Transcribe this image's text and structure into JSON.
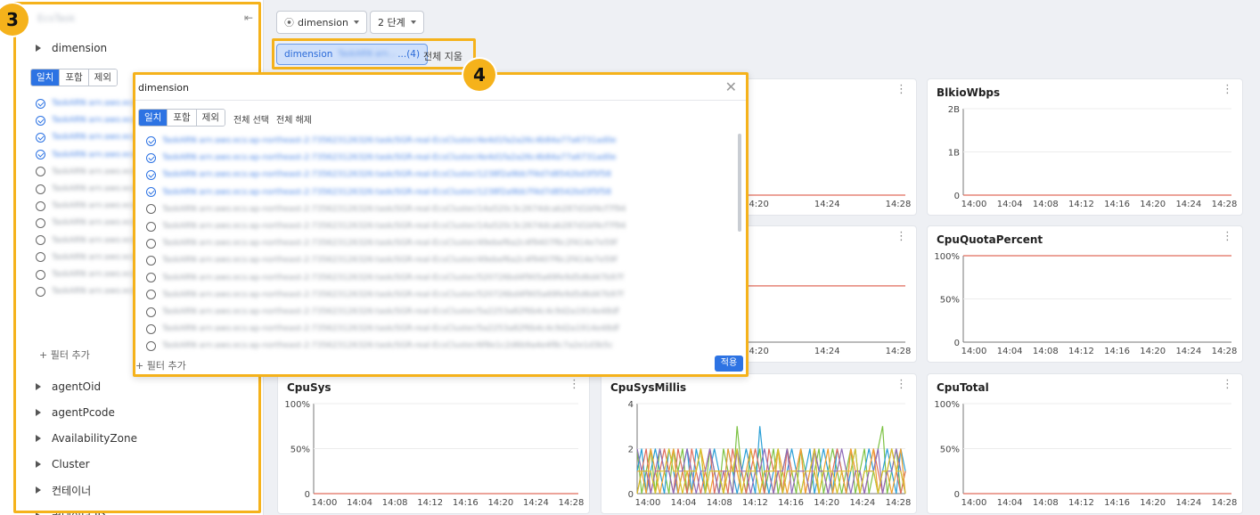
{
  "sidebar": {
    "back_icon": "chevron-left-icon",
    "title": "EcsTask",
    "collapse_icon": "collapse-sidebar-icon",
    "dimension_label": "dimension",
    "match_modes": [
      "일치",
      "포함",
      "제외"
    ],
    "options": [
      {
        "text": "TaskARN arn:aws:ecs",
        "selected": true
      },
      {
        "text": "TaskARN arn:aws:ecs",
        "selected": true
      },
      {
        "text": "TaskARN arn:aws:ecs",
        "selected": true
      },
      {
        "text": "TaskARN arn:aws:ecs",
        "selected": true
      },
      {
        "text": "TaskARN arn:aws:ecs",
        "selected": false
      },
      {
        "text": "TaskARN arn:aws:ecs",
        "selected": false
      },
      {
        "text": "TaskARN arn:aws:ecs",
        "selected": false
      },
      {
        "text": "TaskARN arn:aws:ecs",
        "selected": false
      },
      {
        "text": "TaskARN arn:aws:ecs",
        "selected": false
      },
      {
        "text": "TaskARN arn:aws:ecs",
        "selected": false
      },
      {
        "text": "TaskARN arn:aws:ecs",
        "selected": false
      },
      {
        "text": "TaskARN arn:aws:ecs",
        "selected": false
      }
    ],
    "add_filter": "+ 필터 추가",
    "tree": [
      "agentOid",
      "agentPcode",
      "AvailabilityZone",
      "Cluster",
      "컨테이너",
      "컨테이너 ID"
    ]
  },
  "annotations": {
    "sidebar_badge": "3",
    "filter_badge": "4"
  },
  "toolbar": {
    "group_icon": "group-by-icon",
    "dimension_button": "dimension",
    "level_button": "2 단계",
    "chip_key": "dimension",
    "chip_value": "TaskARN arn...",
    "chip_count": "...(4)",
    "clear_all": "전체 지움"
  },
  "modal": {
    "title": "dimension",
    "close_icon": "close-icon",
    "match_modes": [
      "일치",
      "포함",
      "제외"
    ],
    "select_all": "전체 선택",
    "deselect_all": "전체 해제",
    "options": [
      {
        "text": "TaskARN arn:aws:ecs:ap-northeast-2:735623126326:task/SGR-real-EcsCluster/4e4d1fa2a26c4b84a77a6731ad0e",
        "selected": true
      },
      {
        "text": "TaskARN arn:aws:ecs:ap-northeast-2:735623126326:task/SGR-real-EcsCluster/4e4d1fa2a26c4b84a77a6731ad0e",
        "selected": true
      },
      {
        "text": "TaskARN arn:aws:ecs:ap-northeast-2:735623126326:task/SGR-real-EcsCluster/1238f2a9bb7f4d7d8542bd3f5f58",
        "selected": true
      },
      {
        "text": "TaskARN arn:aws:ecs:ap-northeast-2:735623126326:task/SGR-real-EcsCluster/1238f2a9bb7f4d7d8542bd3f5f58",
        "selected": true
      },
      {
        "text": "TaskARN arn:aws:ecs:ap-northeast-2:735623126326:task/SGR-real-EcsCluster/14a520c3c2674dcab287d1bf4cf7f94",
        "selected": false
      },
      {
        "text": "TaskARN arn:aws:ecs:ap-northeast-2:735623126326:task/SGR-real-EcsCluster/14a520c3c2674dcab287d1bf4cf7f94",
        "selected": false
      },
      {
        "text": "TaskARN arn:aws:ecs:ap-northeast-2:735623126326:task/SGR-real-EcsCluster/49ebef6a2c4f9407f6c2f414e7e59f",
        "selected": false
      },
      {
        "text": "TaskARN arn:aws:ecs:ap-northeast-2:735623126326:task/SGR-real-EcsCluster/49ebef6a2c4f9407f6c2f414e7e59f",
        "selected": false
      },
      {
        "text": "TaskARN arn:aws:ecs:ap-northeast-2:735623126326:task/SGR-real-EcsCluster/520726bd4f905a69fe9d5d6d47b97f",
        "selected": false
      },
      {
        "text": "TaskARN arn:aws:ecs:ap-northeast-2:735623126326:task/SGR-real-EcsCluster/520726bd4f905a69fe9d5d6d47b97f",
        "selected": false
      },
      {
        "text": "TaskARN arn:aws:ecs:ap-northeast-2:735623126326:task/SGR-real-EcsCluster/5a2253a82f6b4c4c9d2a1914e48df",
        "selected": false
      },
      {
        "text": "TaskARN arn:aws:ecs:ap-northeast-2:735623126326:task/SGR-real-EcsCluster/5a2253a82f6b4c4c9d2a1914e48df",
        "selected": false
      },
      {
        "text": "TaskARN arn:aws:ecs:ap-northeast-2:735623126326:task/SGR-real-EcsCluster/6f8e1c2d6b9a4e4f8c7a2e1d3b5c",
        "selected": false
      }
    ],
    "add_filter": "+ 필터 추가",
    "apply": "적용"
  },
  "colors": {
    "accent": "#2d73e3",
    "highlight": "#f5b21b",
    "line_red": "#e06c5c"
  },
  "chart_data": [
    {
      "panel": "BlkioWbps",
      "type": "line",
      "title": "BlkioWbps",
      "y_ticks": [
        "2B",
        "1B",
        "0"
      ],
      "ylim": [
        0,
        2
      ],
      "x_ticks": [
        "14:00",
        "14:04",
        "14:08",
        "14:12",
        "14:16",
        "14:20",
        "14:24",
        "14:28"
      ],
      "series": [
        {
          "values": [
            0,
            0,
            0,
            0,
            0,
            0,
            0,
            0
          ],
          "color": "#e06c5c"
        }
      ]
    },
    {
      "panel": "CpuQuotaPercent",
      "type": "line",
      "title": "CpuQuotaPercent",
      "y_ticks": [
        "100%",
        "50%",
        "0"
      ],
      "ylim": [
        0,
        100
      ],
      "x_ticks": [
        "14:00",
        "14:04",
        "14:08",
        "14:12",
        "14:16",
        "14:20",
        "14:24",
        "14:28"
      ],
      "series": [
        {
          "values": [
            100,
            100,
            100,
            100,
            100,
            100,
            100,
            100
          ],
          "color": "#e06c5c"
        }
      ]
    },
    {
      "panel": "CpuSys",
      "type": "line",
      "title": "CpuSys",
      "y_ticks": [
        "100%",
        "50%",
        "0"
      ],
      "ylim": [
        0,
        100
      ],
      "x_ticks": [
        "14:00",
        "14:04",
        "14:08",
        "14:12",
        "14:16",
        "14:20",
        "14:24",
        "14:28"
      ],
      "series": [
        {
          "values": [
            0,
            0,
            0,
            0,
            0,
            0,
            0,
            0
          ],
          "color": "#e06c5c"
        }
      ]
    },
    {
      "panel": "CpuSysMillis",
      "type": "line",
      "title": "CpuSysMillis",
      "y_ticks": [
        "4",
        "2",
        "0"
      ],
      "ylim": [
        0,
        4
      ],
      "x_ticks": [
        "14:00",
        "14:04",
        "14:08",
        "14:12",
        "14:16",
        "14:20",
        "14:24",
        "14:28"
      ],
      "series": [
        {
          "values": [
            2,
            0,
            1,
            2,
            0,
            2,
            1,
            0,
            2,
            1,
            2,
            0,
            1,
            1,
            2,
            0,
            2,
            1,
            0,
            2,
            1,
            0,
            3,
            1,
            0,
            2,
            1,
            2,
            0,
            1,
            2,
            0,
            1,
            2,
            1,
            0,
            2,
            1,
            0,
            1,
            2,
            0,
            1,
            2,
            1,
            0,
            1,
            2,
            0,
            1,
            2,
            0,
            1,
            2,
            3,
            0,
            1,
            2,
            0,
            1
          ],
          "color": "#7cc243"
        },
        {
          "values": [
            1,
            2,
            0,
            1,
            2,
            1,
            0,
            2,
            1,
            0,
            1,
            2,
            0,
            2,
            1,
            0,
            1,
            2,
            1,
            0,
            2,
            1,
            0,
            1,
            2,
            1,
            0,
            3,
            1,
            0,
            1,
            2,
            0,
            1,
            2,
            1,
            0,
            1,
            2,
            0,
            1,
            2,
            1,
            0,
            2,
            1,
            0,
            1,
            2,
            0,
            1,
            2,
            1,
            0,
            1,
            2,
            1,
            0,
            2,
            1
          ],
          "color": "#2a9fd6"
        },
        {
          "values": [
            0,
            1,
            2,
            0,
            1,
            1,
            2,
            1,
            0,
            2,
            1,
            0,
            2,
            1,
            0,
            1,
            2,
            0,
            1,
            1,
            0,
            2,
            1,
            1,
            0,
            1,
            2,
            1,
            0,
            2,
            1,
            1,
            0,
            2,
            1,
            1,
            2,
            0,
            1,
            2,
            1,
            1,
            0,
            1,
            2,
            1,
            0,
            2,
            1,
            1,
            0,
            1,
            2,
            1,
            0,
            1,
            2,
            1,
            0,
            1
          ],
          "color": "#e06c5c"
        },
        {
          "values": [
            1,
            1,
            0,
            2,
            1,
            0,
            1,
            1,
            2,
            0,
            1,
            1,
            0,
            1,
            2,
            1,
            0,
            1,
            1,
            0,
            2,
            1,
            1,
            0,
            1,
            2,
            1,
            0,
            1,
            1,
            0,
            2,
            1,
            0,
            1,
            1,
            2,
            0,
            1,
            1,
            0,
            1,
            2,
            0,
            1,
            1,
            0,
            2,
            1,
            0,
            1,
            1,
            2,
            0,
            1,
            1,
            0,
            1,
            2,
            0
          ],
          "color": "#f0a030"
        },
        {
          "values": [
            2,
            1,
            1,
            0,
            1,
            2,
            1,
            1,
            0,
            1,
            1,
            2,
            1,
            0,
            1,
            1,
            2,
            1,
            0,
            1,
            1,
            0,
            2,
            1,
            1,
            0,
            1,
            1,
            2,
            1,
            0,
            1,
            1,
            2,
            0,
            1,
            1,
            1,
            0,
            2,
            1,
            1,
            0,
            1,
            1,
            2,
            1,
            0,
            1,
            1,
            0,
            1,
            1,
            2,
            0,
            1,
            1,
            2,
            1,
            0
          ],
          "color": "#8e6bb8"
        },
        {
          "values": [
            0,
            1,
            1,
            1,
            0,
            1,
            1,
            2,
            1,
            1,
            0,
            1,
            1,
            1,
            2,
            0,
            1,
            1,
            1,
            0,
            1,
            1,
            2,
            0,
            1,
            1,
            1,
            0,
            1,
            1,
            1,
            2,
            0,
            1,
            1,
            1,
            0,
            1,
            1,
            2,
            0,
            1,
            1,
            1,
            0,
            1,
            1,
            1,
            2,
            0,
            1,
            1,
            1,
            0,
            1,
            1,
            2,
            1,
            1,
            0
          ],
          "color": "#d4c22a"
        }
      ]
    },
    {
      "panel": "CpuTotal",
      "type": "line",
      "title": "CpuTotal",
      "y_ticks": [
        "100%",
        "50%",
        "0"
      ],
      "ylim": [
        0,
        100
      ],
      "x_ticks": [
        "14:00",
        "14:04",
        "14:08",
        "14:12",
        "14:16",
        "14:20",
        "14:24",
        "14:28"
      ],
      "series": [
        {
          "values": [
            0,
            0,
            0,
            0,
            0,
            0,
            0,
            0
          ],
          "color": "#e06c5c"
        }
      ]
    },
    {
      "panel": "partial-top",
      "type": "line",
      "title": "",
      "y_ticks": [],
      "ylim": [
        0,
        2
      ],
      "x_ticks": [
        "14:12",
        "14:16",
        "14:20",
        "14:24",
        "14:28"
      ],
      "series": [
        {
          "values": [
            0,
            0,
            0,
            0,
            0
          ],
          "color": "#e06c5c"
        }
      ]
    },
    {
      "panel": "partial-mid",
      "type": "line",
      "title": "",
      "y_ticks": [],
      "ylim": [
        0,
        100
      ],
      "x_ticks": [
        "14:12",
        "14:16",
        "14:20",
        "14:24",
        "14:28"
      ],
      "series": [
        {
          "values": [
            65,
            65,
            65,
            65,
            65
          ],
          "color": "#e06c5c"
        }
      ]
    }
  ]
}
